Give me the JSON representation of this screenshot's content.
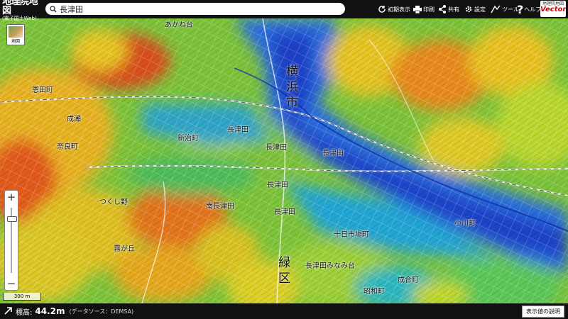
{
  "header": {
    "logo_title": "地理院地図",
    "logo_subtitle": "(電子国土Web)",
    "search_value": "長津田",
    "toolbar": [
      {
        "name": "reset-view-button",
        "label": "初期表示",
        "icon": "reload-icon"
      },
      {
        "name": "print-button",
        "label": "印刷",
        "icon": "printer-icon"
      },
      {
        "name": "share-button",
        "label": "共有",
        "icon": "share-icon"
      },
      {
        "name": "settings-button",
        "label": "設定",
        "icon": "gear-icon"
      },
      {
        "name": "tools-button",
        "label": "ツール",
        "icon": "tools-icon"
      },
      {
        "name": "help-button",
        "label": "ヘルプ",
        "icon": "help-icon"
      }
    ],
    "vector_logo_top": "地理院地図",
    "vector_logo_main": "Vector"
  },
  "map": {
    "layer_button_label": "地図",
    "scale_label": "300 m",
    "big_labels": {
      "city": "横浜市",
      "ward": "緑区"
    },
    "place_labels": [
      {
        "id": "p1",
        "text": "あかね台"
      },
      {
        "id": "p2",
        "text": "長津田"
      },
      {
        "id": "p3",
        "text": "長津田"
      },
      {
        "id": "p4",
        "text": "長津田"
      },
      {
        "id": "p5",
        "text": "長津田"
      },
      {
        "id": "p6",
        "text": "長津田"
      },
      {
        "id": "p7",
        "text": "つくし野"
      },
      {
        "id": "p8",
        "text": "恩田町"
      },
      {
        "id": "p9",
        "text": "南長津田"
      },
      {
        "id": "p10",
        "text": "長津田みなみ台"
      },
      {
        "id": "p11",
        "text": "十日市場町"
      },
      {
        "id": "p12",
        "text": "霧が丘"
      },
      {
        "id": "p13",
        "text": "新治町"
      },
      {
        "id": "p14",
        "text": "成合町"
      },
      {
        "id": "p15",
        "text": "奈良町"
      },
      {
        "id": "p16",
        "text": "小川町"
      },
      {
        "id": "p17",
        "text": "昭和町"
      },
      {
        "id": "p18",
        "text": "成瀬"
      }
    ]
  },
  "footer": {
    "elevation_label": "標高:",
    "elevation_value": "44.2m",
    "data_source": "(データソース：DEMSA)",
    "legend_button": "表示値の説明"
  },
  "colors": {
    "low": "#1e3fd0",
    "mid_low": "#25a8d8",
    "mid": "#5cc73a",
    "mid_high": "#e8d21a",
    "high": "#e8421a"
  }
}
